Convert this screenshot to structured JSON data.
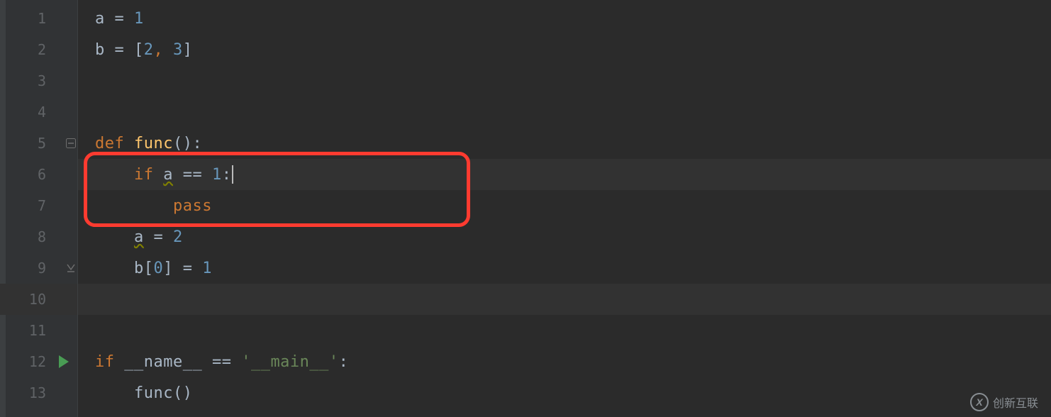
{
  "gutter": {
    "line_numbers": [
      "1",
      "2",
      "3",
      "4",
      "5",
      "6",
      "7",
      "8",
      "9",
      "10",
      "11",
      "12",
      "13"
    ],
    "run_marker_line": 12,
    "fold_start_lines": [
      5
    ],
    "fold_end_lines": [
      9
    ],
    "active_line": 10
  },
  "code": {
    "lines": [
      {
        "tokens": [
          {
            "t": "a",
            "c": "tok-ident"
          },
          {
            "t": " = ",
            "c": "tok-op"
          },
          {
            "t": "1",
            "c": "tok-num"
          }
        ]
      },
      {
        "tokens": [
          {
            "t": "b",
            "c": "tok-ident"
          },
          {
            "t": " = ",
            "c": "tok-op"
          },
          {
            "t": "[",
            "c": "tok-punct"
          },
          {
            "t": "2",
            "c": "tok-num"
          },
          {
            "t": ", ",
            "c": "tok-comma"
          },
          {
            "t": "3",
            "c": "tok-num"
          },
          {
            "t": "]",
            "c": "tok-punct"
          }
        ]
      },
      {
        "tokens": []
      },
      {
        "tokens": []
      },
      {
        "tokens": [
          {
            "t": "def ",
            "c": "tok-kw-b"
          },
          {
            "t": "func",
            "c": "tok-def"
          },
          {
            "t": "():",
            "c": "tok-punct"
          }
        ]
      },
      {
        "active": true,
        "caret_after": true,
        "tokens": [
          {
            "t": "    ",
            "c": ""
          },
          {
            "t": "if ",
            "c": "tok-kw-b"
          },
          {
            "t": "a",
            "c": "tok-ident warn"
          },
          {
            "t": " == ",
            "c": "tok-op"
          },
          {
            "t": "1",
            "c": "tok-num"
          },
          {
            "t": ":",
            "c": "tok-punct"
          }
        ]
      },
      {
        "tokens": [
          {
            "t": "        ",
            "c": ""
          },
          {
            "t": "pass",
            "c": "tok-kw-b"
          }
        ]
      },
      {
        "tokens": [
          {
            "t": "    ",
            "c": ""
          },
          {
            "t": "a",
            "c": "tok-ident warn"
          },
          {
            "t": " = ",
            "c": "tok-op"
          },
          {
            "t": "2",
            "c": "tok-num"
          }
        ]
      },
      {
        "tokens": [
          {
            "t": "    ",
            "c": ""
          },
          {
            "t": "b",
            "c": "tok-ident"
          },
          {
            "t": "[",
            "c": "tok-punct"
          },
          {
            "t": "0",
            "c": "tok-num"
          },
          {
            "t": "]",
            "c": "tok-punct"
          },
          {
            "t": " = ",
            "c": "tok-op"
          },
          {
            "t": "1",
            "c": "tok-num"
          }
        ]
      },
      {
        "active": true,
        "tokens": []
      },
      {
        "tokens": []
      },
      {
        "tokens": [
          {
            "t": "if ",
            "c": "tok-kw-b"
          },
          {
            "t": "__name__",
            "c": "tok-builtin"
          },
          {
            "t": " == ",
            "c": "tok-op"
          },
          {
            "t": "'__main__'",
            "c": "tok-str"
          },
          {
            "t": ":",
            "c": "tok-punct"
          }
        ]
      },
      {
        "tokens": [
          {
            "t": "    ",
            "c": ""
          },
          {
            "t": "func",
            "c": "tok-ident"
          },
          {
            "t": "()",
            "c": "tok-punct"
          }
        ]
      }
    ]
  },
  "annotation": {
    "highlight_lines": [
      6,
      7
    ]
  },
  "watermark": {
    "icon_text": "X",
    "label": "创新互联"
  }
}
